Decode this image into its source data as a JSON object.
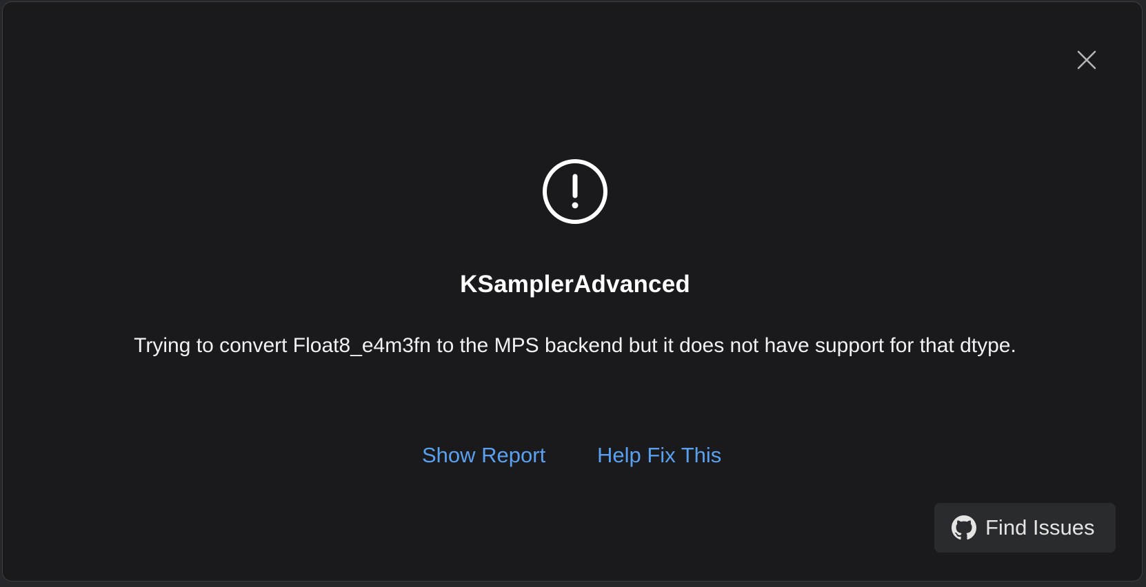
{
  "dialog": {
    "title": "KSamplerAdvanced",
    "message": "Trying to convert Float8_e4m3fn to the MPS backend but it does not have support for that dtype.",
    "show_report_label": "Show Report",
    "help_fix_label": "Help Fix This",
    "find_issues_label": "Find Issues",
    "icons": {
      "close": "close-icon",
      "alert": "exclamation-circle-icon",
      "github": "github-icon"
    }
  },
  "colors": {
    "background": "#1a1a1c",
    "link": "#5aa0f0",
    "button": "#2a2b2e"
  }
}
